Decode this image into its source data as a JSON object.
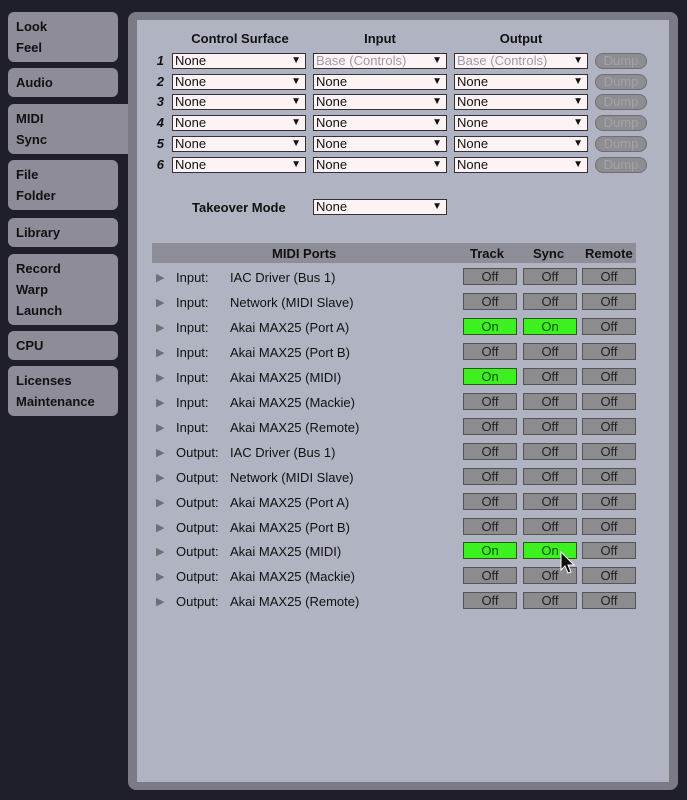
{
  "sidebar": {
    "tabs": [
      {
        "lines": [
          "Look",
          "Feel"
        ]
      },
      {
        "lines": [
          "Audio"
        ]
      },
      {
        "lines": [
          "MIDI",
          "Sync"
        ],
        "active": true
      },
      {
        "lines": [
          "File",
          "Folder"
        ]
      },
      {
        "lines": [
          "Library"
        ]
      },
      {
        "lines": [
          "Record",
          "Warp",
          "Launch"
        ]
      },
      {
        "lines": [
          "CPU"
        ]
      },
      {
        "lines": [
          "Licenses",
          "Maintenance"
        ]
      }
    ]
  },
  "surfaces": {
    "headers": {
      "control_surface": "Control Surface",
      "input": "Input",
      "output": "Output"
    },
    "dump_label": "Dump",
    "rows": [
      {
        "num": "1",
        "control_surface": "None",
        "input": "Base (Controls)",
        "output": "Base (Controls)",
        "disabled": true
      },
      {
        "num": "2",
        "control_surface": "None",
        "input": "None",
        "output": "None"
      },
      {
        "num": "3",
        "control_surface": "None",
        "input": "None",
        "output": "None"
      },
      {
        "num": "4",
        "control_surface": "None",
        "input": "None",
        "output": "None"
      },
      {
        "num": "5",
        "control_surface": "None",
        "input": "None",
        "output": "None"
      },
      {
        "num": "6",
        "control_surface": "None",
        "input": "None",
        "output": "None"
      }
    ]
  },
  "takeover": {
    "label": "Takeover Mode",
    "value": "None"
  },
  "ports": {
    "headers": {
      "ports": "MIDI Ports",
      "track": "Track",
      "sync": "Sync",
      "remote": "Remote"
    },
    "rows": [
      {
        "kind": "Input:",
        "name": "IAC Driver (Bus 1)",
        "track": "Off",
        "sync": "Off",
        "remote": "Off"
      },
      {
        "kind": "Input:",
        "name": "Network (MIDI Slave)",
        "track": "Off",
        "sync": "Off",
        "remote": "Off"
      },
      {
        "kind": "Input:",
        "name": "Akai MAX25 (Port A)",
        "track": "On",
        "sync": "On",
        "remote": "Off"
      },
      {
        "kind": "Input:",
        "name": "Akai MAX25 (Port B)",
        "track": "Off",
        "sync": "Off",
        "remote": "Off"
      },
      {
        "kind": "Input:",
        "name": "Akai MAX25 (MIDI)",
        "track": "On",
        "sync": "Off",
        "remote": "Off"
      },
      {
        "kind": "Input:",
        "name": "Akai MAX25 (Mackie)",
        "track": "Off",
        "sync": "Off",
        "remote": "Off"
      },
      {
        "kind": "Input:",
        "name": "Akai MAX25 (Remote)",
        "track": "Off",
        "sync": "Off",
        "remote": "Off"
      },
      {
        "kind": "Output:",
        "name": "IAC Driver (Bus 1)",
        "track": "Off",
        "sync": "Off",
        "remote": "Off"
      },
      {
        "kind": "Output:",
        "name": "Network (MIDI Slave)",
        "track": "Off",
        "sync": "Off",
        "remote": "Off"
      },
      {
        "kind": "Output:",
        "name": "Akai MAX25 (Port A)",
        "track": "Off",
        "sync": "Off",
        "remote": "Off"
      },
      {
        "kind": "Output:",
        "name": "Akai MAX25 (Port B)",
        "track": "Off",
        "sync": "Off",
        "remote": "Off"
      },
      {
        "kind": "Output:",
        "name": "Akai MAX25 (MIDI)",
        "track": "On",
        "sync": "On",
        "remote": "Off"
      },
      {
        "kind": "Output:",
        "name": "Akai MAX25 (Mackie)",
        "track": "Off",
        "sync": "Off",
        "remote": "Off"
      },
      {
        "kind": "Output:",
        "name": "Akai MAX25 (Remote)",
        "track": "Off",
        "sync": "Off",
        "remote": "Off"
      }
    ]
  },
  "colors": {
    "on": "#3df01f",
    "off": "#8c8c8f",
    "panel": "#b0b4c2",
    "background": "#1f1f2b"
  }
}
